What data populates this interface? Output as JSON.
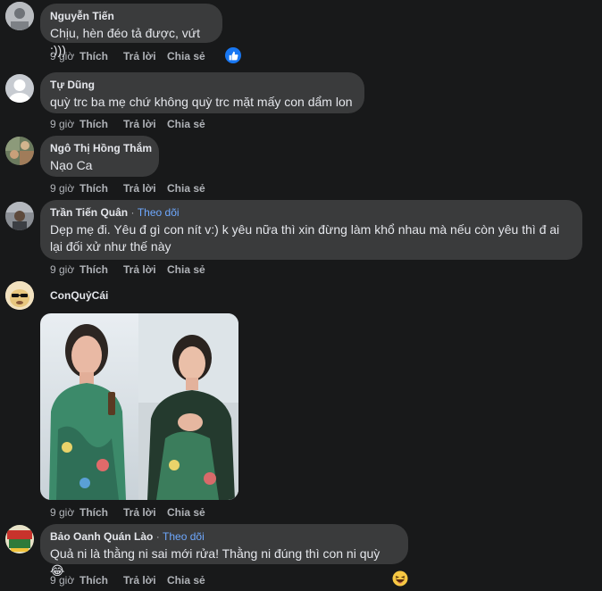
{
  "actions": {
    "time": "9 giờ",
    "like": "Thích",
    "reply": "Trả lời",
    "share": "Chia sẻ"
  },
  "follow_label": "Theo dõi",
  "separator": "·",
  "comments": [
    {
      "author": "Nguyễn Tiến",
      "text": "Chịu, hèn đéo tả được, vứt :)))"
    },
    {
      "author": "Tự Dũng",
      "text": "quỳ trc ba mẹ chứ không quỳ trc mặt mấy con dẩm lon"
    },
    {
      "author": "Ngô Thị Hồng Thắm",
      "text": "Nạo Ca"
    },
    {
      "author": "Trần Tiến Quân",
      "text": "Dẹp mẹ đi. Yêu đ gì con nít v:) k yêu nữa thì xin đừng làm khổ nhau mà nếu còn yêu thì đ ai lại đối xử như thế này"
    },
    {
      "author": "ConQuỷCái"
    },
    {
      "author": "Bảo Oanh Quán Lào",
      "text": "Quả ni là thằng ni sai mới rửa! Thằng ni đúng thì con ni quỳ 😂"
    }
  ],
  "colors": {
    "background": "#18191a",
    "bubble": "#3a3b3c",
    "text": "#e4e6eb",
    "secondary_text": "#b0b3b8",
    "link": "#6ea8fe",
    "like_reaction": "#1877f2"
  },
  "icons": [
    "like-reaction-icon",
    "haha-reaction-icon"
  ]
}
